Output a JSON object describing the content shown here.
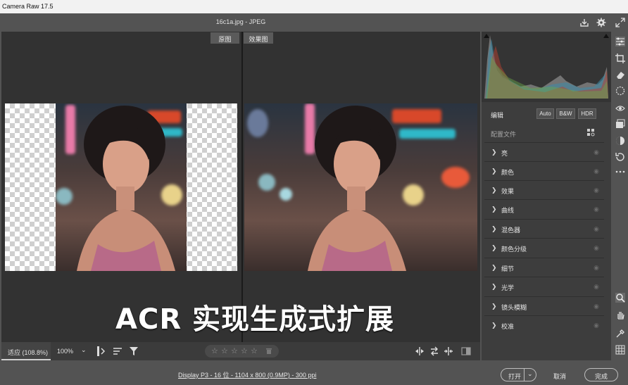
{
  "window": {
    "title": "Camera Raw 17.5"
  },
  "file": {
    "name": "16c1a.jpg -  JPEG"
  },
  "view_tabs": {
    "before": "原图",
    "after": "效果图"
  },
  "caption": "ACR 实现生成式扩展",
  "toolbar": {
    "zoom_fit": "适应 (108.8%)",
    "zoom_percent": "100%",
    "zoom_dropdown": "⌄",
    "rating_stars": [
      "☆",
      "☆",
      "☆",
      "☆",
      "☆"
    ]
  },
  "status": {
    "info": "Display P3 - 16 位 - 1104 x 800 (0.9MP) - 300 ppi"
  },
  "actions": {
    "open": "打开",
    "open_menu": "⌄",
    "cancel": "取消",
    "done": "完成"
  },
  "edit_panel": {
    "title": "编辑",
    "modes": [
      "Auto",
      "B&W",
      "HDR"
    ],
    "profile_label": "配置文件",
    "sections": [
      "亮",
      "颜色",
      "效果",
      "曲线",
      "混色器",
      "颜色分级",
      "细节",
      "光学",
      "镜头模糊",
      "校准"
    ]
  },
  "colors": {
    "bg": "#535353",
    "preview_bg": "#323232",
    "panel_bg": "#3d3d3d",
    "title_bar": "#f2f2f2"
  }
}
